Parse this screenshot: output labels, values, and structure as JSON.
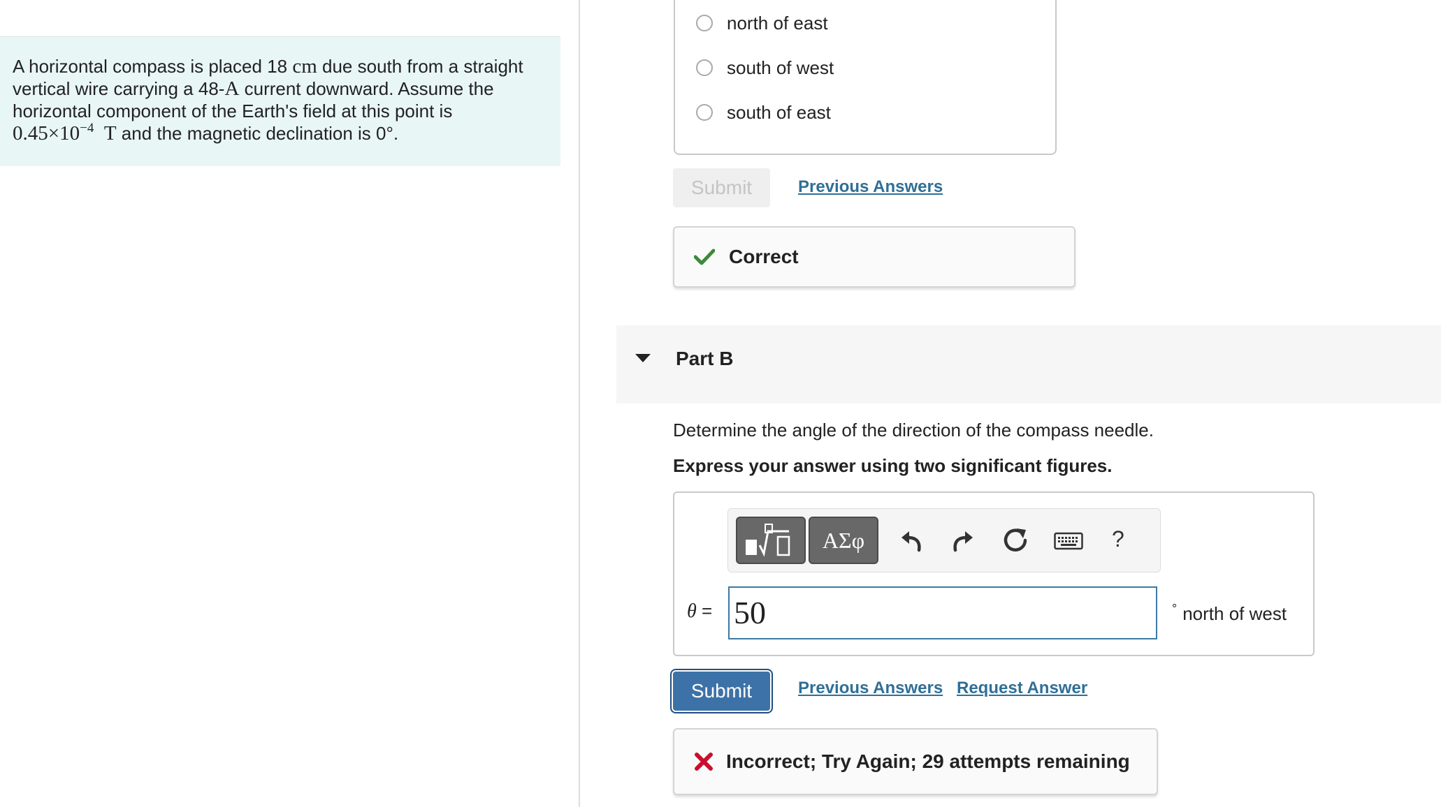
{
  "problem": {
    "text_1": "A horizontal compass is placed 18 ",
    "unit_cm": "cm",
    "text_2": " due south from a straight vertical wire carrying a 48-",
    "unit_A": "A",
    "text_3": " current downward. Assume the horizontal component of the Earth's field at this point is ",
    "field_mantissa": "0.45×10",
    "field_exponent": "−4",
    "unit_T": "T",
    "text_4": " and the magnetic declination is 0°."
  },
  "part_a": {
    "choices": [
      {
        "label": "north of east"
      },
      {
        "label": "south of west"
      },
      {
        "label": "south of east"
      }
    ],
    "submit_label": "Submit",
    "previous_answers_label": "Previous Answers",
    "feedback": "Correct"
  },
  "part_b": {
    "title": "Part B",
    "question": "Determine the angle of the direction of the compass needle.",
    "instruction": "Express your answer using two significant figures.",
    "toolbar": {
      "greek_label": "ΑΣφ",
      "help_label": "?"
    },
    "variable": "θ",
    "equals": " =",
    "answer_value": "50",
    "unit_degree": "°",
    "unit_direction": "north of west",
    "submit_label": "Submit",
    "previous_answers_label": "Previous Answers",
    "request_answer_label": "Request Answer",
    "feedback": "Incorrect; Try Again; 29 attempts remaining"
  },
  "colors": {
    "problem_bg": "#e9f6f6",
    "link": "#2f6f97",
    "submit_active": "#3d72a8",
    "correct_check": "#3b8a3b",
    "incorrect_x": "#c8102e"
  }
}
